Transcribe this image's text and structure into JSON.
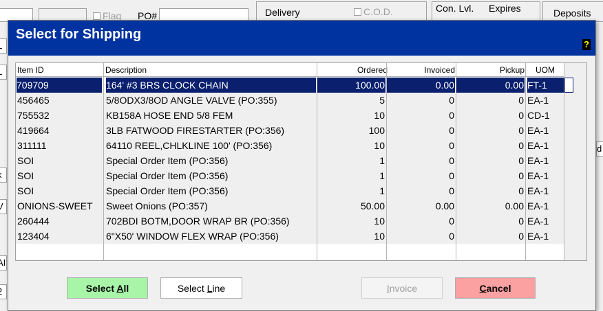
{
  "background": {
    "delivery_label": "Delivery",
    "cod_label": "C.O.D.",
    "con_lvl_label": "Con. Lvl.",
    "expires_label": "Expires",
    "deposits_label": "Deposits",
    "po_label": "PO#",
    "flag_label": "Flag",
    "left_fragments": [
      "05",
      "L",
      "L",
      "k",
      "V",
      "AI",
      "2"
    ],
    "right_fragments": [
      "d"
    ]
  },
  "dialog": {
    "title": "Select for Shipping",
    "help_glyph": "?",
    "columns": [
      "Item ID",
      "Description",
      "Ordered",
      "Invoiced",
      "Pickup",
      "UOM"
    ],
    "rows": [
      {
        "id": "709709",
        "desc": "164' #3 BRS CLOCK CHAIN",
        "ordered": "100.00",
        "invoiced": "0.00",
        "pickup": "0.00",
        "uom": "FT-1"
      },
      {
        "id": "456465",
        "desc": "5/8ODX3/8OD ANGLE VALVE (PO:355)",
        "ordered": "5",
        "invoiced": "0",
        "pickup": "0",
        "uom": "EA-1"
      },
      {
        "id": "755532",
        "desc": "KB158A HOSE END 5/8 FEM",
        "ordered": "10",
        "invoiced": "0",
        "pickup": "0",
        "uom": "CD-1"
      },
      {
        "id": "419664",
        "desc": "3LB FATWOOD FIRESTARTER (PO:356)",
        "ordered": "100",
        "invoiced": "0",
        "pickup": "0",
        "uom": "EA-1"
      },
      {
        "id": "311111",
        "desc": "64110 REEL,CHLKLINE 100' (PO:356)",
        "ordered": "10",
        "invoiced": "0",
        "pickup": "0",
        "uom": "EA-1"
      },
      {
        "id": "SOI",
        "desc": "Special Order Item (PO:356)",
        "ordered": "1",
        "invoiced": "0",
        "pickup": "0",
        "uom": "EA-1"
      },
      {
        "id": "SOI",
        "desc": "Special Order Item (PO:356)",
        "ordered": "1",
        "invoiced": "0",
        "pickup": "0",
        "uom": "EA-1"
      },
      {
        "id": "SOI",
        "desc": "Special Order Item (PO:356)",
        "ordered": "1",
        "invoiced": "0",
        "pickup": "0",
        "uom": "EA-1"
      },
      {
        "id": "ONIONS-SWEET",
        "desc": "Sweet Onions (PO:357)",
        "ordered": "50.00",
        "invoiced": "0.00",
        "pickup": "0.00",
        "uom": "EA-1"
      },
      {
        "id": "260444",
        "desc": "702BDI BOTM,DOOR WRAP BR (PO:356)",
        "ordered": "10",
        "invoiced": "0",
        "pickup": "0",
        "uom": "EA-1"
      },
      {
        "id": "123404",
        "desc": "6\"X50' WINDOW FLEX WRAP (PO:356)",
        "ordered": "10",
        "invoiced": "0",
        "pickup": "0",
        "uom": "EA-1"
      }
    ],
    "selected_row_index": 0,
    "buttons": {
      "select_all": {
        "pre": "Select ",
        "key": "A",
        "post": "ll"
      },
      "select_line": {
        "pre": "Select ",
        "key": "L",
        "post": "ine"
      },
      "invoice": {
        "pre": "",
        "key": "I",
        "post": "nvoice"
      },
      "cancel": {
        "pre": "",
        "key": "C",
        "post": "ancel"
      }
    }
  },
  "colors": {
    "title_bar": "#0033a0",
    "selection": "#0a1f6e",
    "select_all_bg": "#a8f5a8",
    "cancel_bg": "#fba1a1"
  }
}
